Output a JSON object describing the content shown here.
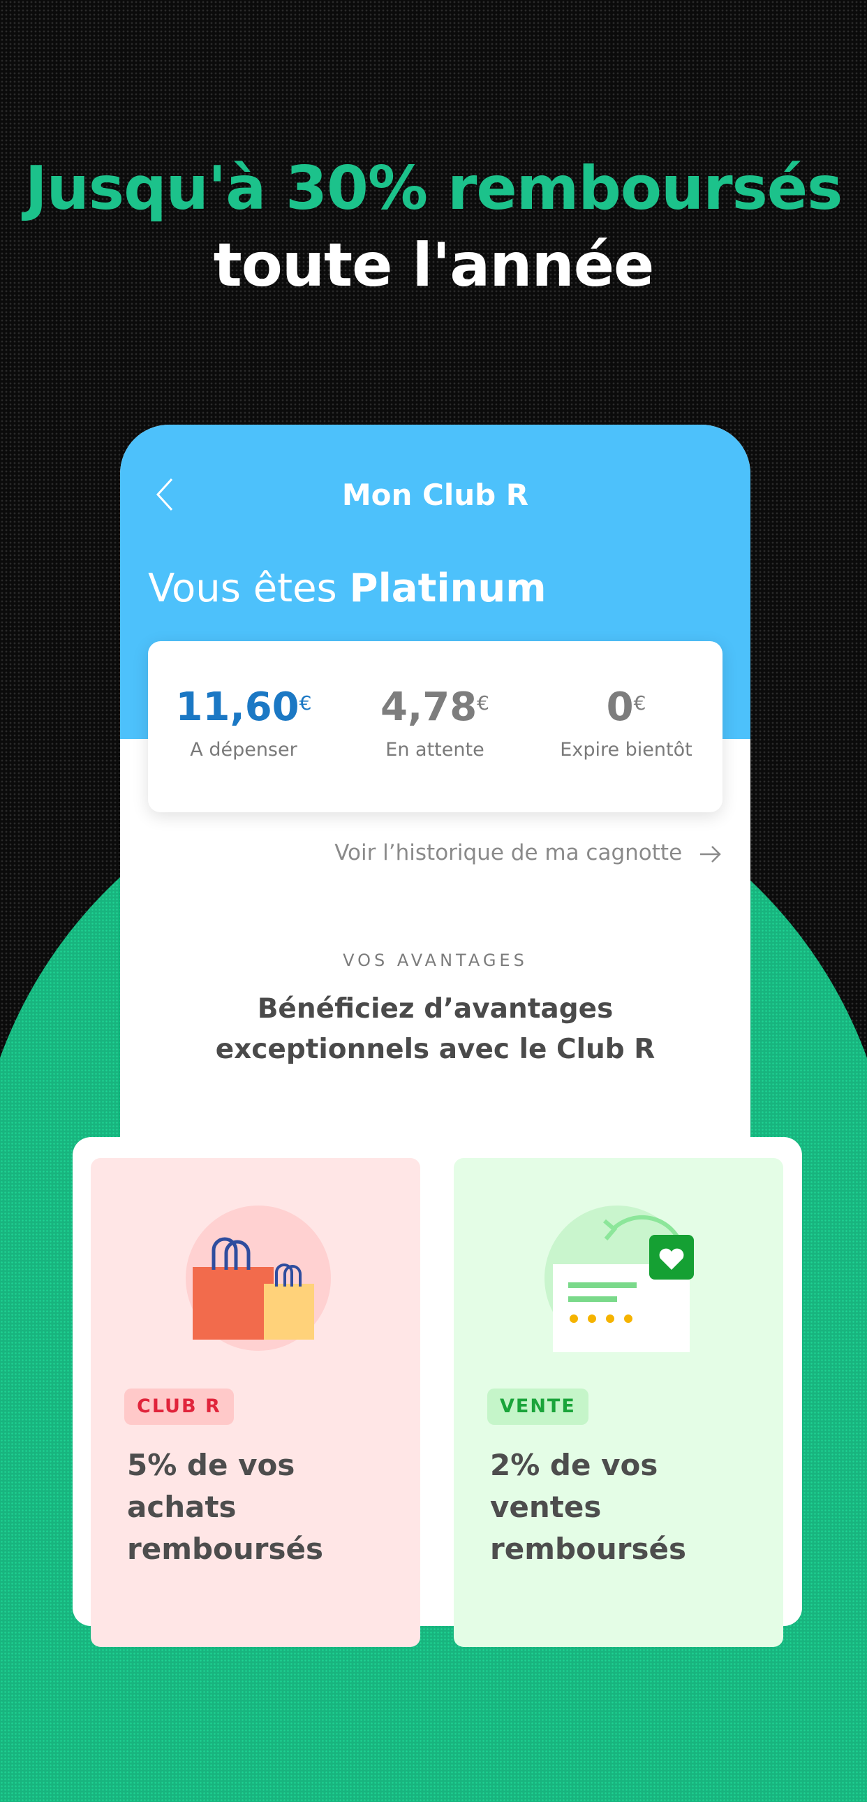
{
  "headline": {
    "line1": "Jusqu'à 30% remboursés",
    "line2": "toute l'année"
  },
  "screen": {
    "title": "Mon Club R",
    "status_prefix": "Vous êtes",
    "status_level": "Platinum"
  },
  "balances": [
    {
      "amount": "11,60",
      "currency": "€",
      "label": "A dépenser"
    },
    {
      "amount": "4,78",
      "currency": "€",
      "label": "En attente"
    },
    {
      "amount": "0",
      "currency": "€",
      "label": "Expire bientôt"
    }
  ],
  "history_link": "Voir l’historique de ma cagnotte",
  "advantages": {
    "kicker": "VOS AVANTAGES",
    "title": "Bénéficiez d’avantages exceptionnels avec le Club R"
  },
  "cards": [
    {
      "tag": "CLUB R",
      "text": "5% de vos achats remboursés",
      "icon": "shopping-bags-icon"
    },
    {
      "tag": "VENTE",
      "text": "2% de vos ventes remboursés",
      "icon": "review-heart-icon"
    }
  ],
  "colors": {
    "accent_green": "#1cc28b",
    "header_blue": "#4dc1fb",
    "amount_blue": "#1b78c4",
    "tag_red": "#e0243b",
    "tag_green": "#1aa43a"
  }
}
